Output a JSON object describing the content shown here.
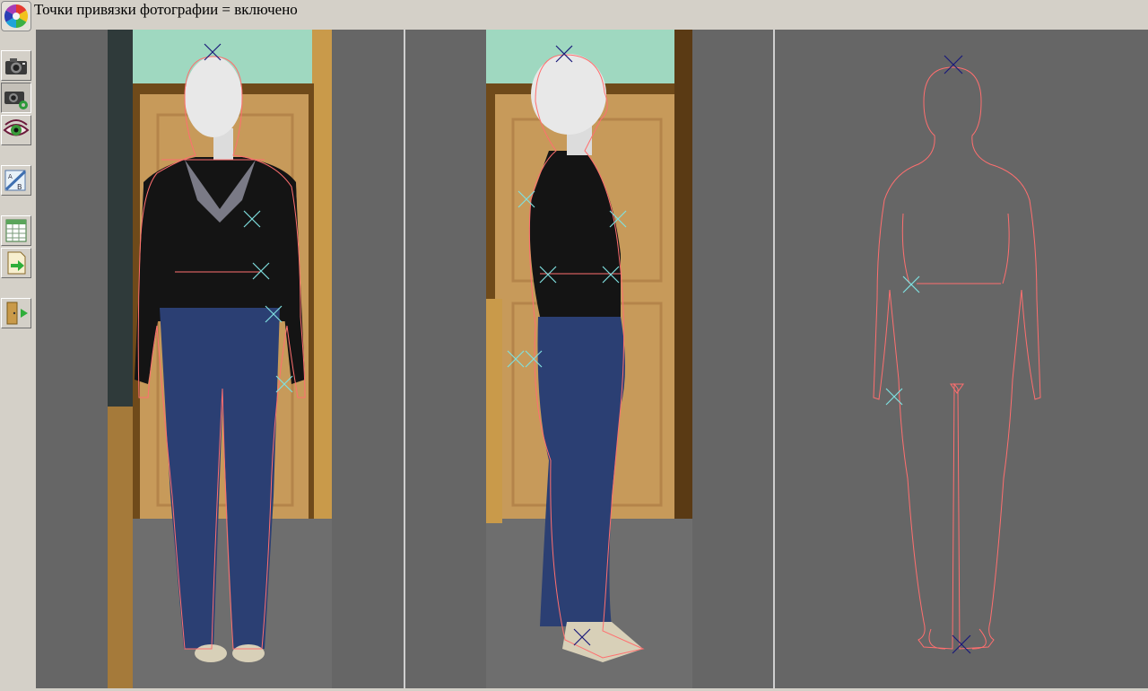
{
  "status": {
    "text": "Точки привязки фотографии = включено"
  },
  "toolbar": {
    "buttons": [
      {
        "name": "color-palette-button",
        "icon": "color-wheel-icon"
      },
      {
        "name": "camera-button",
        "icon": "camera-icon"
      },
      {
        "name": "camera-settings-button",
        "icon": "camera-gear-icon"
      },
      {
        "name": "eye-button",
        "icon": "eye-icon"
      },
      {
        "name": "measure-button",
        "icon": "ruler-icon"
      },
      {
        "name": "table-button",
        "icon": "table-icon"
      },
      {
        "name": "export-button",
        "icon": "document-arrow-icon"
      },
      {
        "name": "exit-button",
        "icon": "door-exit-icon"
      }
    ]
  },
  "colors": {
    "workspace_bg": "#666666",
    "divider": "#cfcfcf",
    "outline": "#ff6f6f",
    "anchor_primary": "#1a1a7a",
    "anchor_secondary": "#7fe0e0",
    "wall": "#9fd8c0",
    "door": "#c79a5a",
    "floor": "#6e6e6e",
    "sweater": "#141414",
    "jeans": "#2b3f73",
    "mannequin": "#e8e8e8"
  },
  "views": [
    {
      "name": "front-photo-view",
      "kind": "photo-front"
    },
    {
      "name": "side-photo-view",
      "kind": "photo-side"
    },
    {
      "name": "outline-view",
      "kind": "outline-back"
    }
  ]
}
